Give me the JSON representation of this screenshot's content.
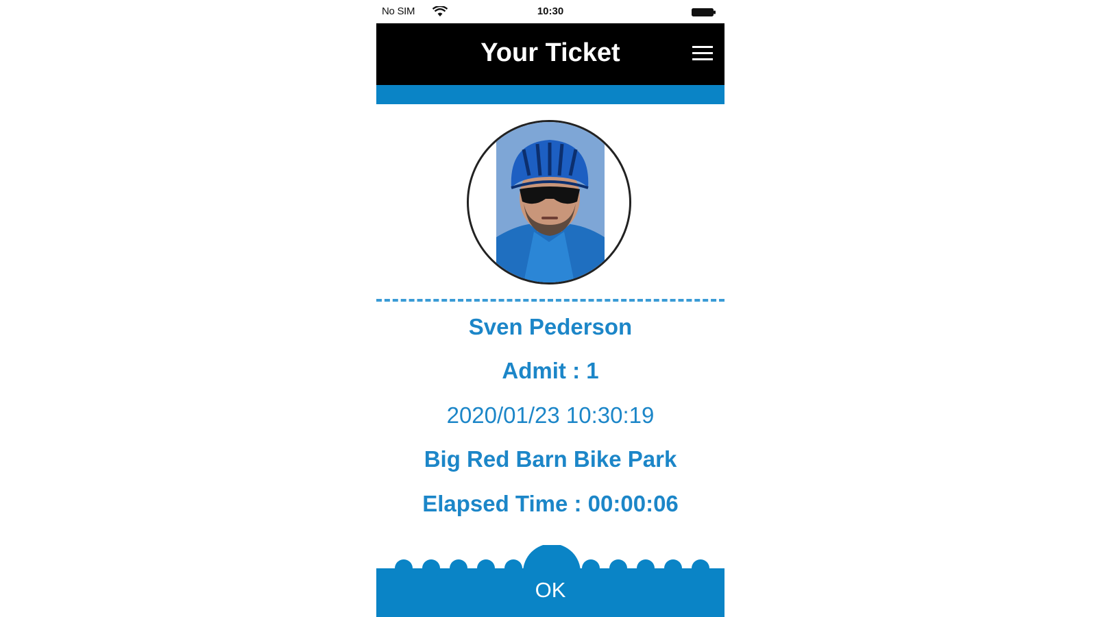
{
  "status_bar": {
    "carrier": "No SIM",
    "time": "10:30",
    "wifi_icon": "wifi-icon",
    "battery_icon": "battery-icon"
  },
  "header": {
    "title": "Your Ticket",
    "menu_icon": "hamburger-menu-icon"
  },
  "ticket": {
    "name": "Sven Pederson",
    "admit": "Admit : 1",
    "datetime": "2020/01/23 10:30:19",
    "venue": "Big Red Barn Bike Park",
    "elapsed": "Elapsed Time : 00:00:06"
  },
  "actions": {
    "ok_label": "OK"
  },
  "colors": {
    "accent": "#0a84c6",
    "text_accent": "#1c86c8",
    "header_bg": "#000000"
  }
}
